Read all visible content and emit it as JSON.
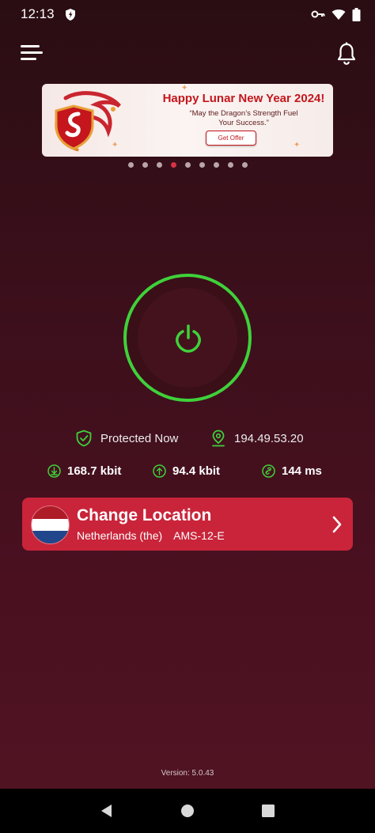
{
  "status_bar": {
    "time": "12:13",
    "icons": [
      "shield-vpn-icon",
      "key-icon",
      "wifi-icon",
      "battery-icon"
    ]
  },
  "header": {
    "menu_icon": "hamburger-menu-icon",
    "notifications_icon": "bell-icon"
  },
  "banner": {
    "title": "Happy Lunar New Year 2024!",
    "subtitle_line1": "“May the Dragon’s Strength Fuel",
    "subtitle_line2": "Your Success.”",
    "button_label": "Get Offer",
    "slides_count": 9,
    "active_slide": 4
  },
  "power": {
    "icon": "power-icon",
    "state_color": "#3fd13a"
  },
  "status": {
    "protection_text": "Protected Now",
    "ip_address": "194.49.53.20"
  },
  "stats": {
    "download": "168.7 kbit",
    "upload": "94.4 kbit",
    "ping": "144 ms"
  },
  "location": {
    "title": "Change Location",
    "country": "Netherlands (the)",
    "server": "AMS-12-E",
    "flag_colors": [
      "#ae1c28",
      "#ffffff",
      "#21468b"
    ]
  },
  "footer": {
    "version": "Version: 5.0.43"
  },
  "colors": {
    "accent_green": "#3fd13a",
    "card_red": "#c9243a",
    "background": "#3b0f1b"
  }
}
